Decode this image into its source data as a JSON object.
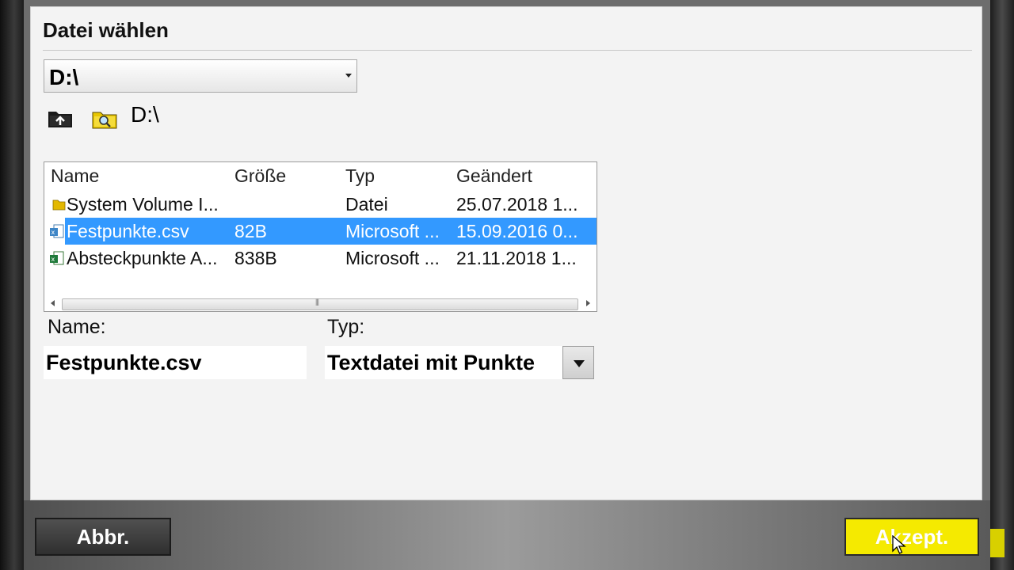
{
  "dialog": {
    "title": "Datei wählen"
  },
  "drive_select": {
    "value": "D:\\"
  },
  "toolbar": {
    "icons": [
      "folder-up-icon",
      "folder-search-icon"
    ],
    "current_path": "D:\\"
  },
  "file_list": {
    "columns": [
      "Name",
      "Größe",
      "Typ",
      "Geändert"
    ],
    "rows": [
      {
        "icon": "folder-icon",
        "name": "System Volume I...",
        "size": "",
        "type": "Datei",
        "modified": "25.07.2018 1...",
        "selected": false
      },
      {
        "icon": "csv-file-icon",
        "name": "Festpunkte.csv",
        "size": "82B",
        "type": "Microsoft ...",
        "modified": "15.09.2016 0...",
        "selected": true
      },
      {
        "icon": "excel-file-icon",
        "name": "Absteckpunkte A...",
        "size": "838B",
        "type": "Microsoft ...",
        "modified": "21.11.2018 1...",
        "selected": false
      }
    ]
  },
  "form": {
    "name_label": "Name:",
    "name_value": "Festpunkte.csv",
    "type_label": "Typ:",
    "type_value": "Textdatei mit Punkte"
  },
  "buttons": {
    "cancel_label": "Abbr.",
    "accept_label": "Akzept."
  },
  "colors": {
    "selection": "#3399ff",
    "accept_button": "#f5ea00",
    "dialog_background": "#f3f3f3"
  }
}
